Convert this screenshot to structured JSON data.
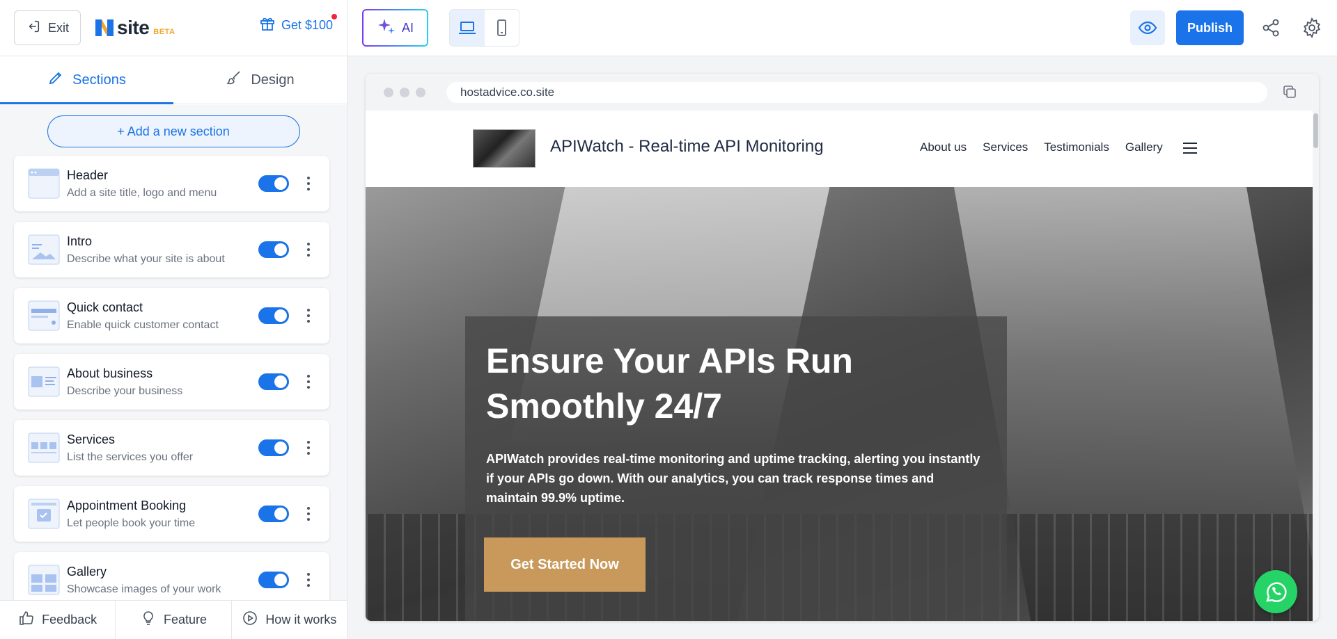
{
  "app": {
    "exit_label": "Exit",
    "logo_word": "site",
    "logo_badge": "BETA",
    "promo_label": "Get $100",
    "accent_color": "#1a73e8"
  },
  "tabs": [
    {
      "label": "Sections",
      "icon": "pencil-icon",
      "active": true
    },
    {
      "label": "Design",
      "icon": "paintbrush-icon",
      "active": false
    }
  ],
  "add_section_label": "+ Add a new section",
  "sections": [
    {
      "title": "Header",
      "desc": "Add a site title, logo and menu",
      "enabled": true
    },
    {
      "title": "Intro",
      "desc": "Describe what your site is about",
      "enabled": true
    },
    {
      "title": "Quick contact",
      "desc": "Enable quick customer contact",
      "enabled": true
    },
    {
      "title": "About business",
      "desc": "Describe your business",
      "enabled": true
    },
    {
      "title": "Services",
      "desc": "List the services you offer",
      "enabled": true
    },
    {
      "title": "Appointment Booking",
      "desc": "Let people book your time",
      "enabled": true
    },
    {
      "title": "Gallery",
      "desc": "Showcase images of your work",
      "enabled": true
    }
  ],
  "bottom_bar": [
    {
      "label": "Feedback",
      "icon": "thumbs-up-icon"
    },
    {
      "label": "Feature",
      "icon": "lightbulb-icon"
    },
    {
      "label": "How it works",
      "icon": "play-circle-icon"
    }
  ],
  "toolbar": {
    "ai_label": "AI",
    "active_device": "desktop",
    "publish_label": "Publish"
  },
  "browser": {
    "url": "hostadvice.co.site"
  },
  "site": {
    "title": "APIWatch - Real-time API Monitoring",
    "nav_links": [
      "About us",
      "Services",
      "Testimonials",
      "Gallery"
    ],
    "hero_heading": "Ensure Your APIs Run Smoothly 24/7",
    "hero_text": "APIWatch provides real-time monitoring and uptime tracking, alerting you instantly if your APIs go down. With our analytics, you can track response times and maintain 99.9% uptime.",
    "cta_label": "Get Started Now",
    "cta_color": "#c8995a"
  }
}
